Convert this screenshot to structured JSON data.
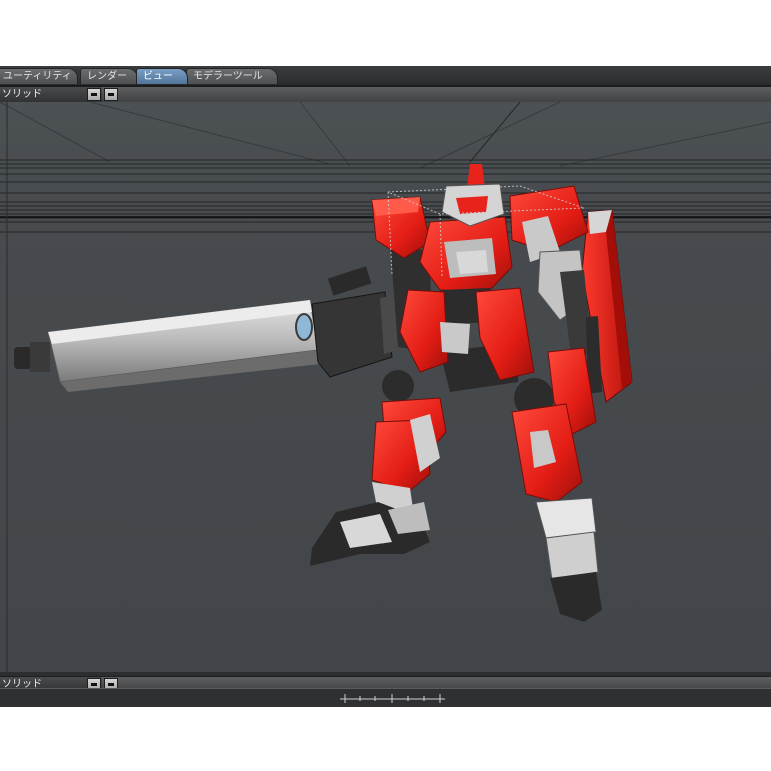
{
  "tabs": [
    {
      "label": "ユーティリティ",
      "active": false
    },
    {
      "label": "レンダー",
      "active": false
    },
    {
      "label": "ビュー",
      "active": true
    },
    {
      "label": "モデラーツール",
      "active": false
    }
  ],
  "viewport_top": {
    "mode_label": "ソリッド"
  },
  "viewport_bottom": {
    "mode_label": "ソリッド"
  },
  "colors": {
    "accent_tab": "#5f85ad",
    "viewport_bg": "#44484b",
    "model_red": "#e8231c",
    "model_gray": "#c8c8c8",
    "model_dark": "#2c2c2c"
  },
  "scene": {
    "subject": "red-mecha-robot-with-long-cannon-and-shield"
  }
}
